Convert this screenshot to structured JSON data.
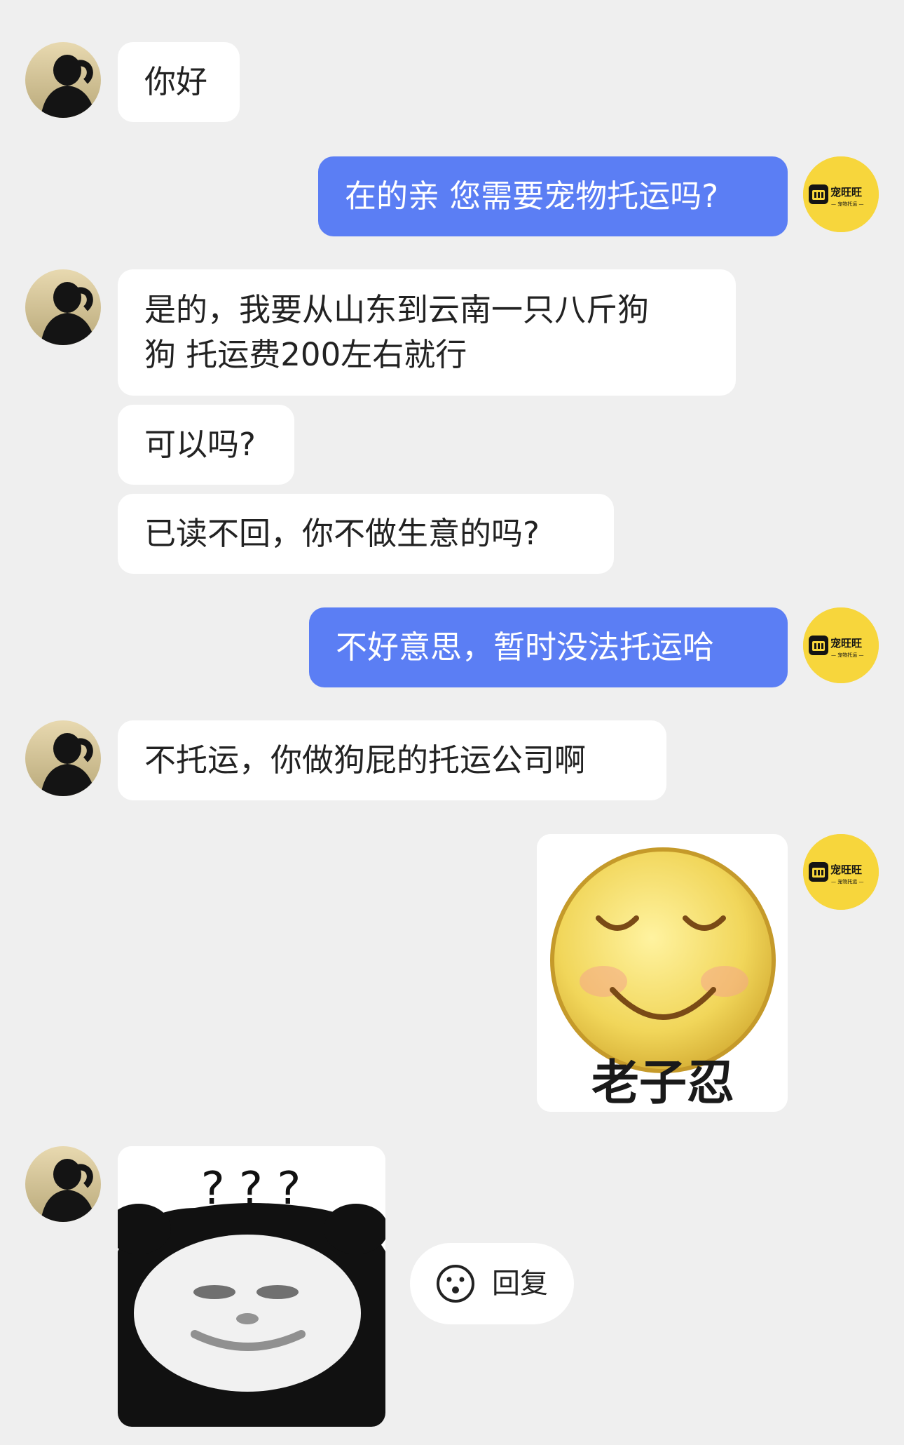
{
  "page": {
    "width": 1290,
    "height": 2060,
    "background": "#efefef"
  },
  "colors": {
    "incoming_bubble": "#ffffff",
    "outgoing_bubble": "#5b7ef4",
    "shop_avatar": "#f7d63c"
  },
  "shop_avatar": {
    "logo_title": "宠旺旺",
    "logo_subtitle": "— 宠物托运 —"
  },
  "messages": [
    {
      "sender": "customer",
      "type": "text",
      "lines": [
        "你好"
      ]
    },
    {
      "sender": "shop",
      "type": "text",
      "lines": [
        "在的亲 您需要宠物托运吗?"
      ]
    },
    {
      "sender": "customer",
      "type": "text",
      "lines": [
        "是的，我要从山东到云南一只八斤狗",
        "狗 托运费200左右就行"
      ]
    },
    {
      "sender": "customer",
      "type": "text",
      "lines": [
        "可以吗?"
      ]
    },
    {
      "sender": "customer",
      "type": "text",
      "lines": [
        "已读不回，你不做生意的吗?"
      ]
    },
    {
      "sender": "shop",
      "type": "text",
      "lines": [
        "不好意思，暂时没法托运哈"
      ]
    },
    {
      "sender": "customer",
      "type": "text",
      "lines": [
        "不托运，你做狗屁的托运公司啊"
      ]
    },
    {
      "sender": "shop",
      "type": "sticker",
      "sticker": "smiling-face",
      "caption": "老子忍"
    },
    {
      "sender": "customer",
      "type": "sticker",
      "sticker": "panda-confused",
      "caption": "? ? ?"
    }
  ],
  "reply_button": {
    "icon": "smiley-icon",
    "label": "回复"
  }
}
